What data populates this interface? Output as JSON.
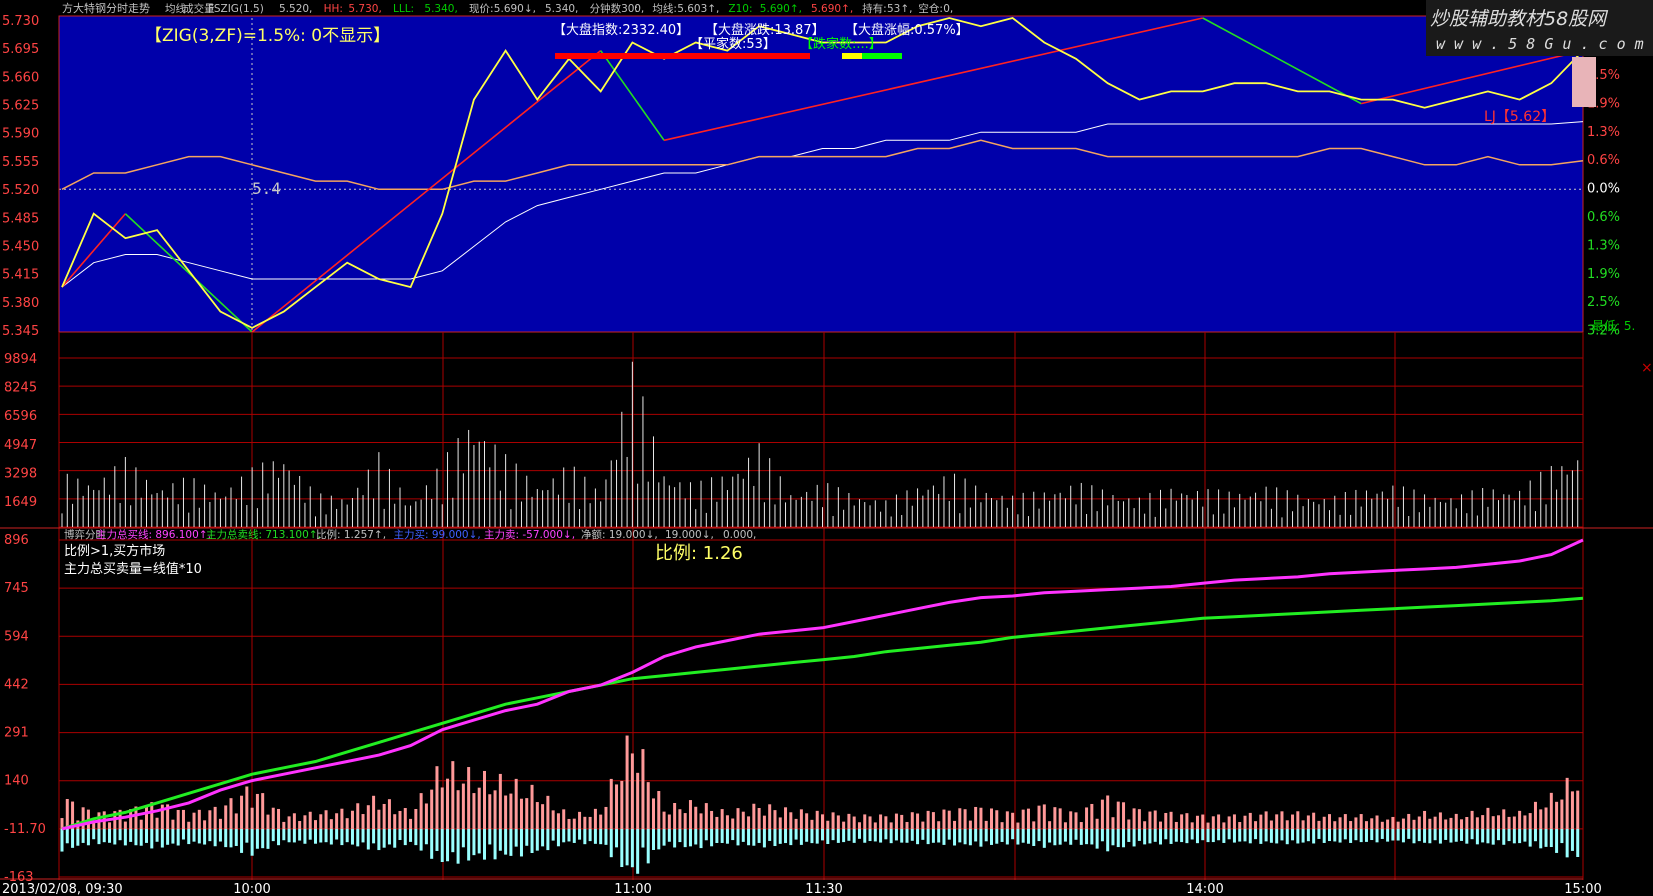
{
  "header": {
    "title": "方大特钢分时走势",
    "items": [
      "均线",
      "成交量",
      "FSZIG(1.5)",
      "5.520,",
      "HH:",
      "5.730,",
      "LLL:",
      "5.340,",
      "现价:",
      "5.690↓,",
      "5.340,",
      "分钟数30:",
      "0,",
      "均线:",
      "5.603↑,",
      "Z10:",
      "5.690↑,",
      "5.690↑,",
      "持有:",
      "53↑,",
      "空仓:",
      "0,"
    ]
  },
  "watermark": {
    "line1": "炒股辅助教材58股网",
    "line2": "w w w . 5 8 G u . c o m"
  },
  "price_panel": {
    "zig_label": "【ZIG(3,ZF)=1.5%:  0不显示】",
    "index_label": "【大盘指数:2332.40】",
    "index_change": "【大盘涨跌:13.87】",
    "index_pct": "【大盘涨幅:0.57%】",
    "flat_count": "【平家数:53】",
    "down_count": "【跌家数:...】",
    "lj_label": "LJ【5.62】",
    "marker_54": "5.4",
    "y_ticks": [
      "5.730",
      "5.695",
      "5.660",
      "5.625",
      "5.590",
      "5.555",
      "5.520",
      "5.485",
      "5.450",
      "5.415",
      "5.380",
      "5.345"
    ],
    "pct_ticks": [
      "1.5%",
      "1.9%",
      "1.3%",
      "0.6%",
      "0.0%",
      "0.6%",
      "1.3%",
      "1.9%",
      "2.5%",
      "3.2%"
    ],
    "right_clip": "最低: 5."
  },
  "volume_panel": {
    "y_ticks": [
      "9894",
      "8245",
      "6596",
      "4947",
      "3298",
      "1649"
    ]
  },
  "ratio_panel": {
    "header_items": [
      {
        "text": "博弈分时",
        "color": "#c0c0c0"
      },
      {
        "text": "主力总买线: 896.100↑,",
        "color": "#ff44ff"
      },
      {
        "text": "主力总卖线: 713.100↑,",
        "color": "#22dd22"
      },
      {
        "text": "比例: 1.257↑,",
        "color": "#c0c0c0"
      },
      {
        "text": "主力买: 99.000↓,",
        "color": "#4060ff"
      },
      {
        "text": "主力卖: -57.000↓,",
        "color": "#ff44ff"
      },
      {
        "text": "净额: 19.000↓,",
        "color": "#c0c0c0"
      },
      {
        "text": "19.000↓,",
        "color": "#c0c0c0"
      },
      {
        "text": "0.000,",
        "color": "#c0c0c0"
      }
    ],
    "note1": "比例>1,买方市场",
    "note2": "主力总买卖量=线值*10",
    "ratio_label": "比例: 1.26",
    "y_ticks": [
      "896",
      "745",
      "594",
      "442",
      "291",
      "140",
      "-11.70",
      "-163"
    ]
  },
  "time_axis": {
    "labels": [
      "2013/02/08, 09:30",
      "10:00",
      "11:00",
      "11:30",
      "14:00",
      "15:00"
    ]
  },
  "chart_data": {
    "type": "line",
    "x_time": [
      "09:30",
      "09:35",
      "09:40",
      "09:45",
      "09:50",
      "09:55",
      "10:00",
      "10:05",
      "10:10",
      "10:15",
      "10:20",
      "10:25",
      "10:30",
      "10:35",
      "10:40",
      "10:45",
      "10:50",
      "10:55",
      "11:00",
      "11:05",
      "11:10",
      "11:15",
      "11:20",
      "11:25",
      "11:30",
      "13:05",
      "13:10",
      "13:15",
      "13:20",
      "13:25",
      "13:30",
      "13:35",
      "13:40",
      "13:45",
      "13:50",
      "13:55",
      "14:00",
      "14:05",
      "14:10",
      "14:15",
      "14:20",
      "14:25",
      "14:30",
      "14:35",
      "14:40",
      "14:45",
      "14:50",
      "14:55",
      "15:00"
    ],
    "price": [
      5.4,
      5.49,
      5.46,
      5.47,
      5.42,
      5.37,
      5.35,
      5.37,
      5.4,
      5.43,
      5.41,
      5.4,
      5.49,
      5.63,
      5.69,
      5.63,
      5.68,
      5.64,
      5.7,
      5.68,
      5.7,
      5.69,
      5.72,
      5.71,
      5.7,
      5.7,
      5.7,
      5.72,
      5.73,
      5.72,
      5.73,
      5.7,
      5.68,
      5.65,
      5.63,
      5.64,
      5.64,
      5.65,
      5.65,
      5.64,
      5.64,
      5.63,
      5.63,
      5.62,
      5.63,
      5.64,
      5.63,
      5.65,
      5.69
    ],
    "avg_price": [
      5.4,
      5.43,
      5.44,
      5.44,
      5.43,
      5.42,
      5.41,
      5.41,
      5.41,
      5.41,
      5.41,
      5.41,
      5.42,
      5.45,
      5.48,
      5.5,
      5.51,
      5.52,
      5.53,
      5.54,
      5.54,
      5.55,
      5.56,
      5.56,
      5.57,
      5.57,
      5.58,
      5.58,
      5.58,
      5.59,
      5.59,
      5.59,
      5.59,
      5.6,
      5.6,
      5.6,
      5.6,
      5.6,
      5.6,
      5.6,
      5.6,
      5.6,
      5.6,
      5.6,
      5.6,
      5.6,
      5.6,
      5.6,
      5.603
    ],
    "index_line": [
      5.52,
      5.54,
      5.54,
      5.55,
      5.56,
      5.56,
      5.55,
      5.54,
      5.53,
      5.53,
      5.52,
      5.52,
      5.52,
      5.53,
      5.53,
      5.54,
      5.55,
      5.55,
      5.55,
      5.55,
      5.55,
      5.55,
      5.56,
      5.56,
      5.56,
      5.56,
      5.56,
      5.57,
      5.57,
      5.58,
      5.57,
      5.57,
      5.57,
      5.56,
      5.56,
      5.56,
      5.56,
      5.56,
      5.56,
      5.56,
      5.57,
      5.57,
      5.56,
      5.55,
      5.55,
      5.56,
      5.55,
      5.55,
      5.555
    ],
    "zig": [
      [
        0,
        5.4
      ],
      [
        2,
        5.49
      ],
      [
        6,
        5.345
      ],
      [
        17,
        5.69
      ],
      [
        19,
        5.58
      ],
      [
        36,
        5.73
      ],
      [
        41,
        5.625
      ],
      [
        48,
        5.69
      ]
    ],
    "volume": [
      3200,
      2800,
      4100,
      2500,
      3000,
      2200,
      3500,
      4500,
      2000,
      1800,
      4400,
      1500,
      3900,
      6800,
      4300,
      2600,
      3800,
      2200,
      9800,
      3400,
      2600,
      3300,
      5000,
      2100,
      2700,
      2000,
      1600,
      2500,
      3300,
      2400,
      1900,
      2200,
      2700,
      2200,
      1800,
      2400,
      2300,
      2100,
      2500,
      2000,
      1800,
      2300,
      2600,
      2000,
      1900,
      2400,
      2300,
      3700,
      4700
    ],
    "buy_line": [
      -11.7,
      10,
      25,
      45,
      70,
      110,
      140,
      160,
      180,
      200,
      220,
      250,
      300,
      330,
      360,
      380,
      420,
      440,
      480,
      530,
      560,
      580,
      600,
      610,
      620,
      640,
      660,
      680,
      700,
      715,
      720,
      730,
      735,
      740,
      745,
      750,
      760,
      770,
      775,
      780,
      790,
      795,
      800,
      805,
      810,
      820,
      830,
      850,
      896
    ],
    "sell_line": [
      -11.7,
      20,
      40,
      70,
      100,
      130,
      160,
      180,
      200,
      230,
      260,
      290,
      320,
      350,
      380,
      400,
      420,
      440,
      460,
      470,
      480,
      490,
      500,
      510,
      520,
      530,
      545,
      555,
      565,
      575,
      590,
      600,
      610,
      620,
      630,
      640,
      650,
      655,
      660,
      665,
      670,
      675,
      680,
      685,
      690,
      695,
      700,
      705,
      713
    ],
    "net_bars": [
      60,
      30,
      -35,
      50,
      -30,
      40,
      80,
      -25,
      30,
      35,
      60,
      -30,
      120,
      100,
      90,
      70,
      -25,
      35,
      180,
      -40,
      50,
      -30,
      45,
      -35,
      30,
      -25,
      25,
      30,
      -35,
      40,
      -30,
      45,
      -30,
      60,
      -35,
      30,
      -25,
      25,
      -30,
      30,
      -25,
      25,
      -20,
      30,
      -25,
      35,
      -30,
      60,
      110
    ],
    "ylim_price": [
      5.345,
      5.73
    ],
    "ylim_volume": [
      0,
      9894
    ],
    "ylim_ratio": [
      -163,
      896
    ]
  }
}
